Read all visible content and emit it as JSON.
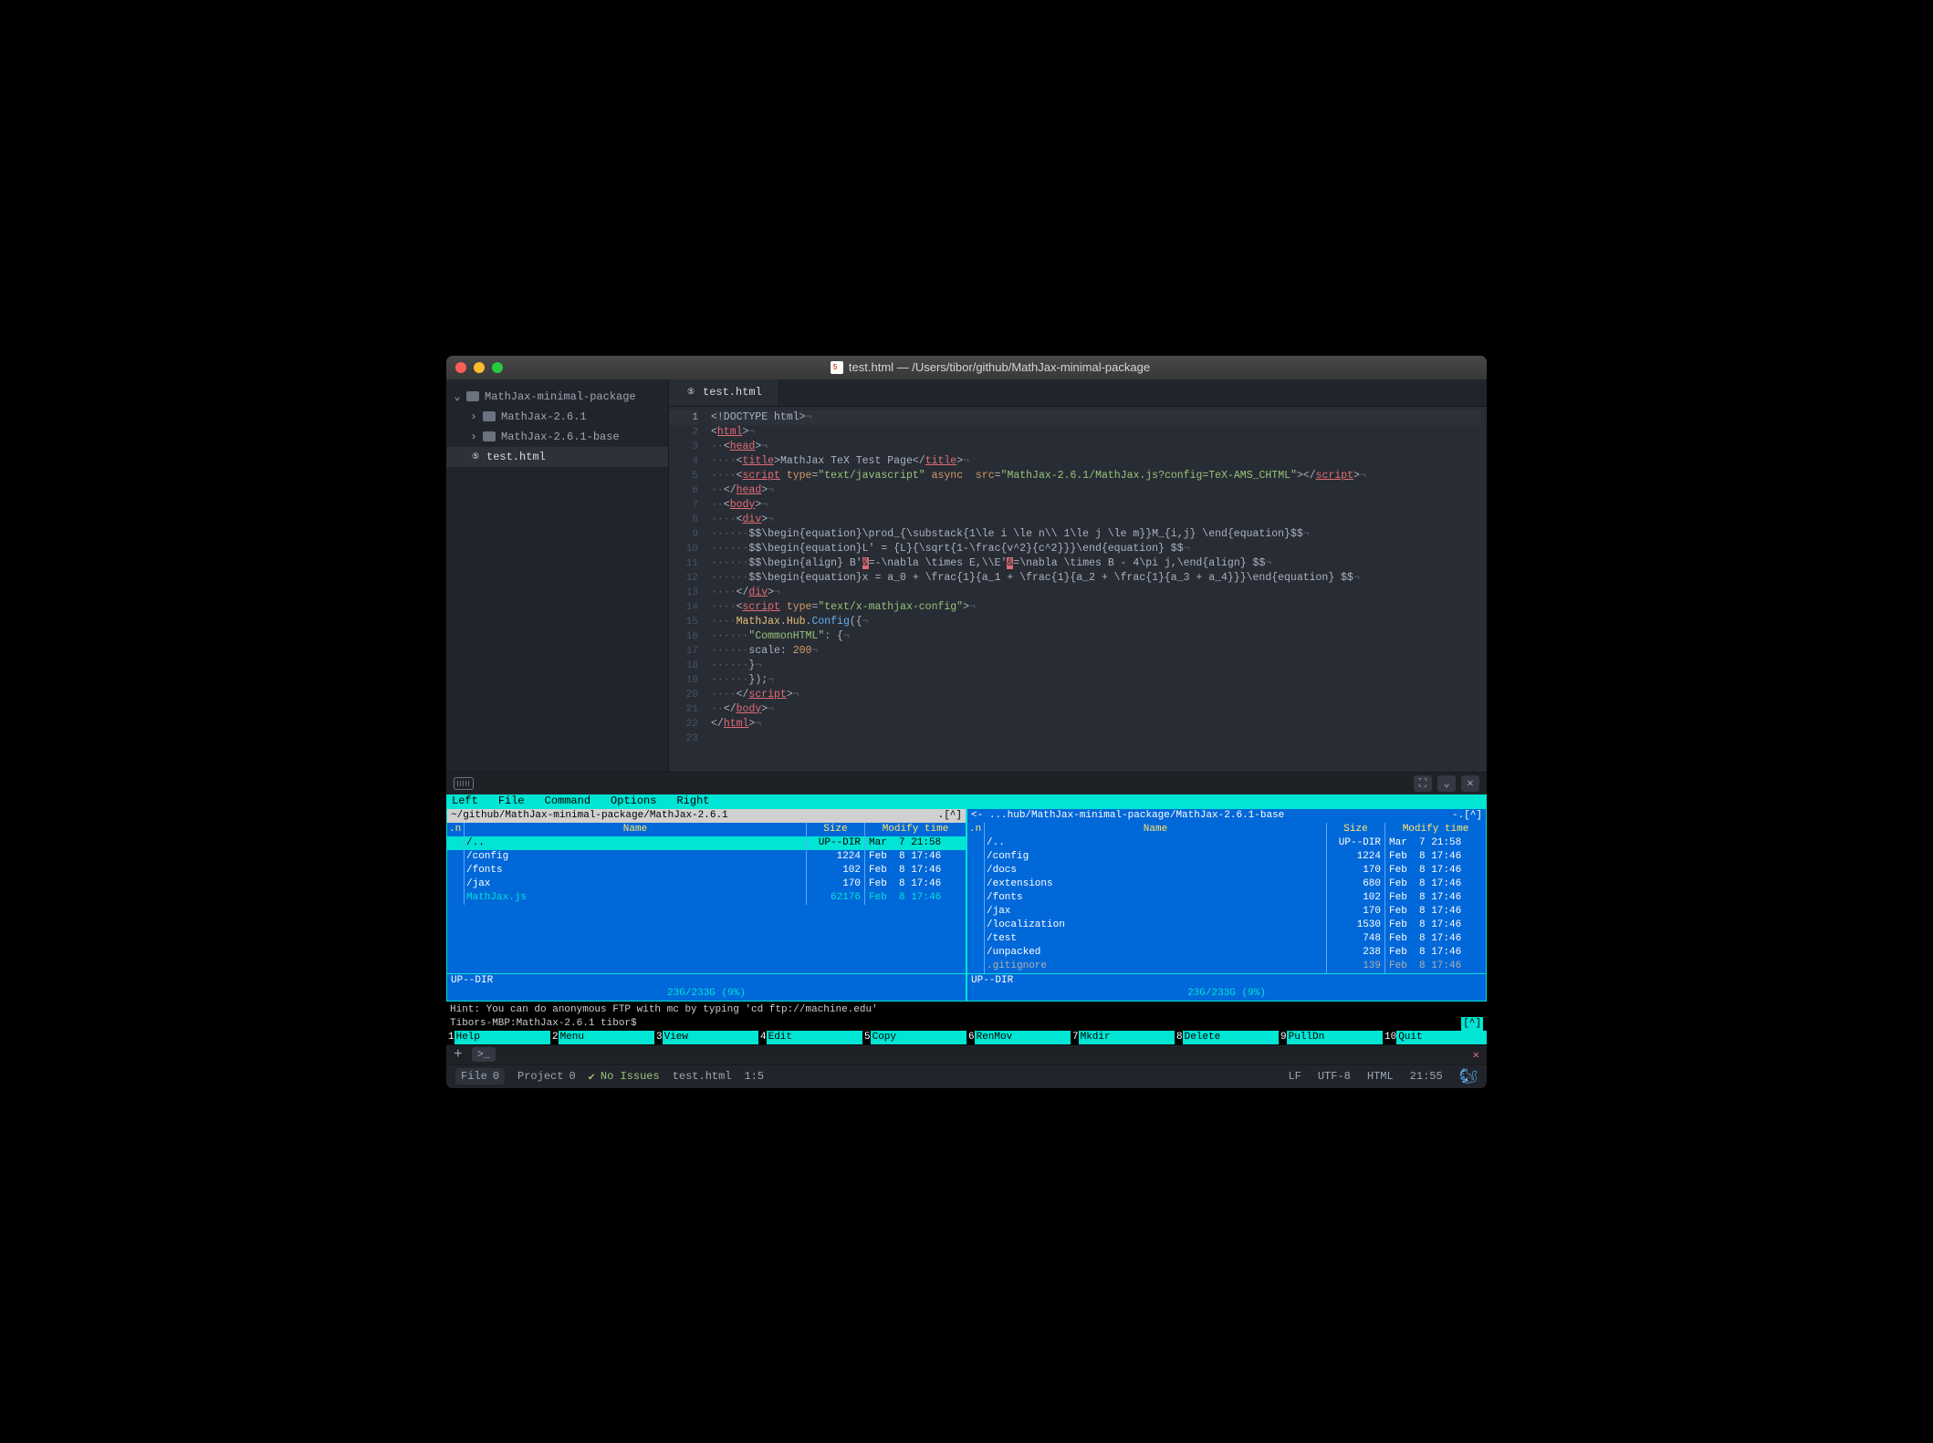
{
  "window": {
    "title": "test.html — /Users/tibor/github/MathJax-minimal-package"
  },
  "sidebar": {
    "root": "MathJax-minimal-package",
    "items": [
      {
        "label": "MathJax-2.6.1",
        "type": "folder"
      },
      {
        "label": "MathJax-2.6.1-base",
        "type": "folder"
      },
      {
        "label": "test.html",
        "type": "file-html"
      }
    ]
  },
  "tab": {
    "label": "test.html"
  },
  "code": {
    "lines": [
      {
        "n": 1,
        "seg": [
          {
            "t": "<!DOCTYPE html>",
            "c": "c-pun"
          },
          {
            "t": "¬",
            "c": "inv"
          }
        ]
      },
      {
        "n": 2,
        "seg": [
          {
            "t": "<",
            "c": "c-pun"
          },
          {
            "t": "html",
            "c": "c-tag"
          },
          {
            "t": ">",
            "c": "c-pun"
          },
          {
            "t": "¬",
            "c": "inv"
          }
        ]
      },
      {
        "n": 3,
        "seg": [
          {
            "t": "··",
            "c": "inv"
          },
          {
            "t": "<",
            "c": "c-pun"
          },
          {
            "t": "head",
            "c": "c-tag"
          },
          {
            "t": ">",
            "c": "c-pun"
          },
          {
            "t": "¬",
            "c": "inv"
          }
        ]
      },
      {
        "n": 4,
        "seg": [
          {
            "t": "····",
            "c": "inv"
          },
          {
            "t": "<",
            "c": "c-pun"
          },
          {
            "t": "title",
            "c": "c-tag"
          },
          {
            "t": ">",
            "c": "c-pun"
          },
          {
            "t": "MathJax TeX Test Page",
            "c": "c-pun"
          },
          {
            "t": "</",
            "c": "c-pun"
          },
          {
            "t": "title",
            "c": "c-tag"
          },
          {
            "t": ">",
            "c": "c-pun"
          },
          {
            "t": "¬",
            "c": "inv"
          }
        ]
      },
      {
        "n": 5,
        "seg": [
          {
            "t": "····",
            "c": "inv"
          },
          {
            "t": "<",
            "c": "c-pun"
          },
          {
            "t": "script",
            "c": "c-tag"
          },
          {
            "t": " ",
            "c": "c-pun"
          },
          {
            "t": "type",
            "c": "c-attr"
          },
          {
            "t": "=",
            "c": "c-pun"
          },
          {
            "t": "\"text/javascript\"",
            "c": "c-str"
          },
          {
            "t": " ",
            "c": "c-pun"
          },
          {
            "t": "async",
            "c": "c-attr"
          },
          {
            "t": "  ",
            "c": "c-pun"
          },
          {
            "t": "src",
            "c": "c-attr"
          },
          {
            "t": "=",
            "c": "c-pun"
          },
          {
            "t": "\"MathJax-2.6.1/MathJax.js?config=TeX-AMS_CHTML\"",
            "c": "c-str"
          },
          {
            "t": "></",
            "c": "c-pun"
          },
          {
            "t": "script",
            "c": "c-tag"
          },
          {
            "t": ">",
            "c": "c-pun"
          },
          {
            "t": "¬",
            "c": "inv"
          }
        ]
      },
      {
        "n": 6,
        "seg": [
          {
            "t": "··",
            "c": "inv"
          },
          {
            "t": "</",
            "c": "c-pun"
          },
          {
            "t": "head",
            "c": "c-tag"
          },
          {
            "t": ">",
            "c": "c-pun"
          },
          {
            "t": "¬",
            "c": "inv"
          }
        ]
      },
      {
        "n": 7,
        "seg": [
          {
            "t": "··",
            "c": "inv"
          },
          {
            "t": "<",
            "c": "c-pun"
          },
          {
            "t": "body",
            "c": "c-tag"
          },
          {
            "t": ">",
            "c": "c-pun"
          },
          {
            "t": "¬",
            "c": "inv"
          }
        ]
      },
      {
        "n": 8,
        "seg": [
          {
            "t": "····",
            "c": "inv"
          },
          {
            "t": "<",
            "c": "c-pun"
          },
          {
            "t": "div",
            "c": "c-tag"
          },
          {
            "t": ">",
            "c": "c-pun"
          },
          {
            "t": "¬",
            "c": "inv"
          }
        ]
      },
      {
        "n": 9,
        "seg": [
          {
            "t": "······",
            "c": "inv"
          },
          {
            "t": "$$\\begin{equation}\\prod_{\\substack{1\\le i \\le n\\\\ 1\\le j \\le m}}M_{i,j} \\end{equation}$$",
            "c": "c-pun"
          },
          {
            "t": "¬",
            "c": "inv"
          }
        ]
      },
      {
        "n": 10,
        "seg": [
          {
            "t": "······",
            "c": "inv"
          },
          {
            "t": "$$\\begin{equation}L' = {L}{\\sqrt{1-\\frac{v^2}{c^2}}}\\end{equation} $$",
            "c": "c-pun"
          },
          {
            "t": "¬",
            "c": "inv"
          }
        ]
      },
      {
        "n": 11,
        "seg": [
          {
            "t": "······",
            "c": "inv"
          },
          {
            "t": "$$\\begin{align} B'",
            "c": "c-pun"
          },
          {
            "t": "&",
            "c": "err"
          },
          {
            "t": "=-\\nabla \\times E,\\\\E'",
            "c": "c-pun"
          },
          {
            "t": "&",
            "c": "err"
          },
          {
            "t": "=\\nabla \\times B - 4\\pi j,\\end{align} $$",
            "c": "c-pun"
          },
          {
            "t": "¬",
            "c": "inv"
          }
        ]
      },
      {
        "n": 12,
        "seg": [
          {
            "t": "······",
            "c": "inv"
          },
          {
            "t": "$$\\begin{equation}x = a_0 + \\frac{1}{a_1 + \\frac{1}{a_2 + \\frac{1}{a_3 + a_4}}}\\end{equation} $$",
            "c": "c-pun"
          },
          {
            "t": "¬",
            "c": "inv"
          }
        ]
      },
      {
        "n": 13,
        "seg": [
          {
            "t": "····",
            "c": "inv"
          },
          {
            "t": "</",
            "c": "c-pun"
          },
          {
            "t": "div",
            "c": "c-tag"
          },
          {
            "t": ">",
            "c": "c-pun"
          },
          {
            "t": "¬",
            "c": "inv"
          }
        ]
      },
      {
        "n": 14,
        "seg": [
          {
            "t": "····",
            "c": "inv"
          },
          {
            "t": "<",
            "c": "c-pun"
          },
          {
            "t": "script",
            "c": "c-tag"
          },
          {
            "t": " ",
            "c": "c-pun"
          },
          {
            "t": "type",
            "c": "c-attr"
          },
          {
            "t": "=",
            "c": "c-pun"
          },
          {
            "t": "\"text/x-mathjax-config\"",
            "c": "c-str"
          },
          {
            "t": ">",
            "c": "c-pun"
          },
          {
            "t": "¬",
            "c": "inv"
          }
        ]
      },
      {
        "n": 15,
        "seg": [
          {
            "t": "····",
            "c": "inv"
          },
          {
            "t": "MathJax",
            "c": "c-obj"
          },
          {
            "t": ".",
            "c": "c-pun"
          },
          {
            "t": "Hub",
            "c": "c-obj"
          },
          {
            "t": ".",
            "c": "c-pun"
          },
          {
            "t": "Config",
            "c": "c-fn"
          },
          {
            "t": "({",
            "c": "c-pun"
          },
          {
            "t": "¬",
            "c": "inv"
          }
        ]
      },
      {
        "n": 16,
        "seg": [
          {
            "t": "······",
            "c": "inv"
          },
          {
            "t": "\"CommonHTML\"",
            "c": "c-str"
          },
          {
            "t": ": {",
            "c": "c-pun"
          },
          {
            "t": "¬",
            "c": "inv"
          }
        ]
      },
      {
        "n": 17,
        "seg": [
          {
            "t": "······",
            "c": "inv"
          },
          {
            "t": "scale: ",
            "c": "c-pun"
          },
          {
            "t": "200",
            "c": "c-num"
          },
          {
            "t": "¬",
            "c": "inv"
          }
        ]
      },
      {
        "n": 18,
        "seg": [
          {
            "t": "······",
            "c": "inv"
          },
          {
            "t": "}",
            "c": "c-pun"
          },
          {
            "t": "¬",
            "c": "inv"
          }
        ]
      },
      {
        "n": 19,
        "seg": [
          {
            "t": "······",
            "c": "inv"
          },
          {
            "t": "});",
            "c": "c-pun"
          },
          {
            "t": "¬",
            "c": "inv"
          }
        ]
      },
      {
        "n": 20,
        "seg": [
          {
            "t": "····",
            "c": "inv"
          },
          {
            "t": "</",
            "c": "c-pun"
          },
          {
            "t": "script",
            "c": "c-tag"
          },
          {
            "t": ">",
            "c": "c-pun"
          },
          {
            "t": "¬",
            "c": "inv"
          }
        ]
      },
      {
        "n": 21,
        "seg": [
          {
            "t": "··",
            "c": "inv"
          },
          {
            "t": "</",
            "c": "c-pun"
          },
          {
            "t": "body",
            "c": "c-tag"
          },
          {
            "t": ">",
            "c": "c-pun"
          },
          {
            "t": "¬",
            "c": "inv"
          }
        ]
      },
      {
        "n": 22,
        "seg": [
          {
            "t": "</",
            "c": "c-pun"
          },
          {
            "t": "html",
            "c": "c-tag"
          },
          {
            "t": ">",
            "c": "c-pun"
          },
          {
            "t": "¬",
            "c": "inv"
          }
        ]
      },
      {
        "n": 23,
        "seg": []
      }
    ],
    "current_line": 1
  },
  "mc": {
    "menu": [
      "Left",
      "File",
      "Command",
      "Options",
      "Right"
    ],
    "left": {
      "path": "~/github/MathJax-minimal-package/MathJax-2.6.1",
      "tag": ".[^]",
      "cols": {
        "n": ".n",
        "name": "Name",
        "size": "Size",
        "date": "Modify time"
      },
      "rows": [
        {
          "name": "/..",
          "size": "UP--DIR",
          "date": "Mar  7 21:58",
          "sel": true
        },
        {
          "name": "/config",
          "size": "1224",
          "date": "Feb  8 17:46"
        },
        {
          "name": "/fonts",
          "size": "102",
          "date": "Feb  8 17:46"
        },
        {
          "name": "/jax",
          "size": "170",
          "date": "Feb  8 17:46"
        },
        {
          "name": " MathJax.js",
          "size": "62176",
          "date": "Feb  8 17:46",
          "hi": true
        }
      ],
      "status": "UP--DIR",
      "footer": "23G/233G (9%)"
    },
    "right": {
      "path": "...hub/MathJax-minimal-package/MathJax-2.6.1-base",
      "tag": "-.[^]",
      "cols": {
        "n": ".n",
        "name": "Name",
        "size": "Size",
        "date": "Modify time"
      },
      "rows": [
        {
          "name": "/..",
          "size": "UP--DIR",
          "date": "Mar  7 21:58"
        },
        {
          "name": "/config",
          "size": "1224",
          "date": "Feb  8 17:46"
        },
        {
          "name": "/docs",
          "size": "170",
          "date": "Feb  8 17:46"
        },
        {
          "name": "/extensions",
          "size": "680",
          "date": "Feb  8 17:46"
        },
        {
          "name": "/fonts",
          "size": "102",
          "date": "Feb  8 17:46"
        },
        {
          "name": "/jax",
          "size": "170",
          "date": "Feb  8 17:46"
        },
        {
          "name": "/localization",
          "size": "1530",
          "date": "Feb  8 17:46"
        },
        {
          "name": "/test",
          "size": "748",
          "date": "Feb  8 17:46"
        },
        {
          "name": "/unpacked",
          "size": "238",
          "date": "Feb  8 17:46"
        },
        {
          "name": " .gitignore",
          "size": "139",
          "date": "Feb  8 17:46",
          "file": true
        }
      ],
      "status": "UP--DIR",
      "footer": "23G/233G (9%)"
    },
    "hint": "Hint: You can do anonymous FTP with mc by typing 'cd ftp://machine.edu'",
    "prompt": "Tibors-MBP:MathJax-2.6.1 tibor$",
    "caret": "[^]",
    "fkeys": [
      {
        "n": "1",
        "l": "Help"
      },
      {
        "n": "2",
        "l": "Menu"
      },
      {
        "n": "3",
        "l": "View"
      },
      {
        "n": "4",
        "l": "Edit"
      },
      {
        "n": "5",
        "l": "Copy"
      },
      {
        "n": "6",
        "l": "RenMov"
      },
      {
        "n": "7",
        "l": "Mkdir"
      },
      {
        "n": "8",
        "l": "Delete"
      },
      {
        "n": "9",
        "l": "PullDn"
      },
      {
        "n": "10",
        "l": "Quit"
      }
    ]
  },
  "status": {
    "file_label": "File",
    "file_count": "0",
    "project_label": "Project",
    "project_count": "0",
    "issues": "No Issues",
    "filename": "test.html",
    "pos": "1:5",
    "eol": "LF",
    "enc": "UTF-8",
    "lang": "HTML",
    "time": "21:55"
  }
}
